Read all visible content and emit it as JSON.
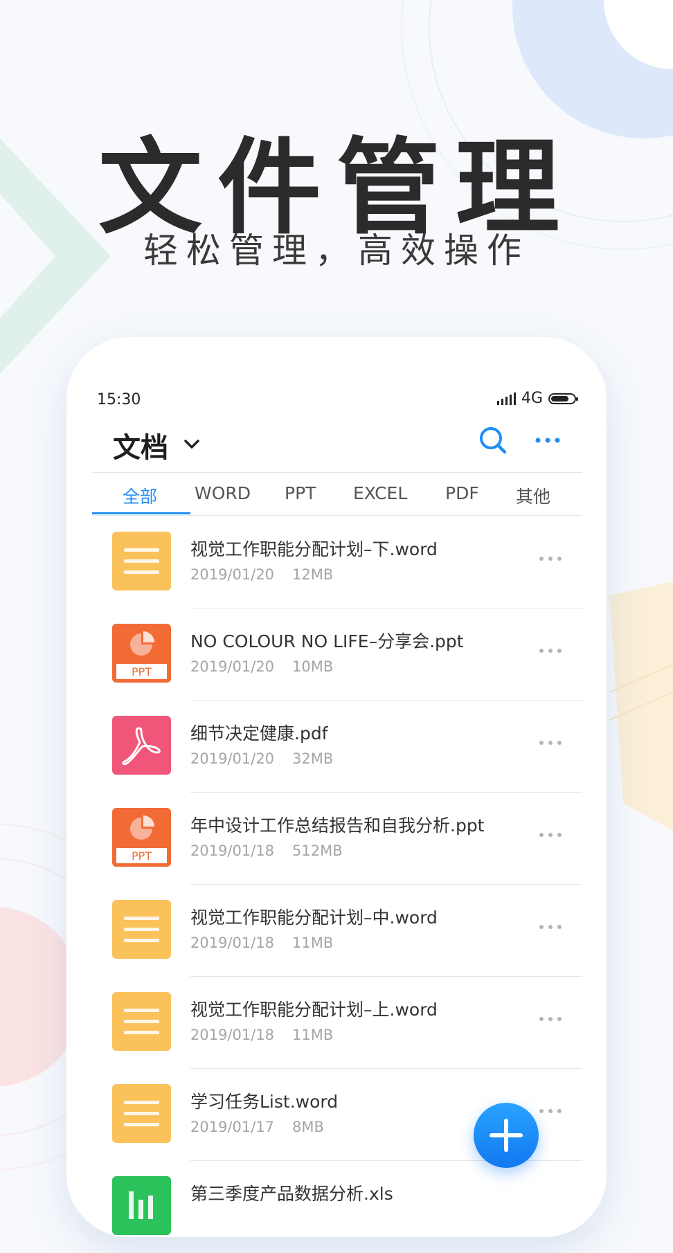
{
  "hero": {
    "title": "文件管理",
    "subtitle": "轻松管理，高效操作"
  },
  "status_bar": {
    "time": "15:30",
    "network": "4G"
  },
  "header": {
    "title": "文档",
    "icons": [
      "chevron-down-icon",
      "search-icon",
      "more-icon"
    ]
  },
  "tabs": [
    "全部",
    "WORD",
    "PPT",
    "EXCEL",
    "PDF",
    "其他"
  ],
  "active_tab": "全部",
  "files": [
    {
      "name": "视觉工作职能分配计划–下.word",
      "date": "2019/01/20",
      "size": "12MB",
      "type": "word"
    },
    {
      "name": "NO COLOUR NO LIFE–分享会.ppt",
      "date": "2019/01/20",
      "size": "10MB",
      "type": "ppt"
    },
    {
      "name": "细节决定健康.pdf",
      "date": "2019/01/20",
      "size": "32MB",
      "type": "pdf"
    },
    {
      "name": "年中设计工作总结报告和自我分析.ppt",
      "date": "2019/01/18",
      "size": "512MB",
      "type": "ppt"
    },
    {
      "name": "视觉工作职能分配计划–中.word",
      "date": "2019/01/18",
      "size": "11MB",
      "type": "word"
    },
    {
      "name": "视觉工作职能分配计划–上.word",
      "date": "2019/01/18",
      "size": "11MB",
      "type": "word"
    },
    {
      "name": "学习任务List.word",
      "date": "2019/01/17",
      "size": "8MB",
      "type": "word"
    },
    {
      "name": "第三季度产品数据分析.xls",
      "date": "",
      "size": "",
      "type": "excel"
    }
  ],
  "ppt_icon_label": "PPT",
  "colors": {
    "accent": "#1e8ef5",
    "word": "#fbc25c",
    "ppt": "#f26b34",
    "pdf": "#f0567a",
    "excel": "#2cc25b"
  }
}
